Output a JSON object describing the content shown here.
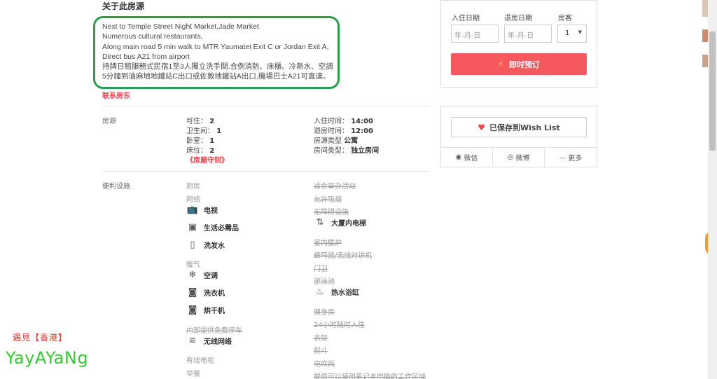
{
  "about": {
    "title": "关于此房源",
    "description": "Next to Temple Street Night Market,Jade Market\nNumerous cultural restaurants,\nAlong main road 5 min walk to MTR Yaumatei Exit C or Jordan Exit A,\nDirect bus A21 from airport\n持牌日租服務式民宿1至3人獨立洗手間,合例消防、床櫃、冷熱水、空調\n5分鐘到油麻地地鐵站C出口或佐敦地鐵站A出口,機場巴士A21可直達。",
    "contact": "联系房东"
  },
  "listing": {
    "section": "房源",
    "left": [
      {
        "k": "可住：",
        "v": "2"
      },
      {
        "k": "卫生间：",
        "v": "1"
      },
      {
        "k": "卧室：",
        "v": "1"
      },
      {
        "k": "床位：",
        "v": "2"
      }
    ],
    "rules": "《房屋守则》",
    "right": [
      {
        "k": "入住时间：",
        "v": "14:00"
      },
      {
        "k": "退房时间：",
        "v": "12:00"
      },
      {
        "k": "房源类型",
        "v": "公寓"
      },
      {
        "k": "房间类型：",
        "v": "独立房间"
      }
    ]
  },
  "amenities": {
    "section": "便利设施",
    "col1": [
      {
        "t": "厨房",
        "s": "off2"
      },
      {
        "t": "网络",
        "s": "off2"
      },
      {
        "t": "电视",
        "s": "on",
        "icon": "tv-icon",
        "g": "📺"
      },
      {
        "t": "生活必需品",
        "s": "on",
        "icon": "essentials-icon",
        "g": "▣"
      },
      {
        "t": "洗发水",
        "s": "on",
        "icon": "shampoo-icon",
        "g": "▯"
      },
      {
        "t": "暖气",
        "s": "off2"
      },
      {
        "t": "空调",
        "s": "on",
        "icon": "snowflake-icon",
        "g": "❄"
      },
      {
        "t": "洗衣机",
        "s": "on",
        "icon": "washer-icon",
        "g": "◙"
      },
      {
        "t": "烘干机",
        "s": "on",
        "icon": "dryer-icon",
        "g": "◙"
      },
      {
        "t": "内部提供免费停车",
        "s": "off"
      },
      {
        "t": "无线网络",
        "s": "on",
        "icon": "wifi-icon",
        "g": "≋"
      },
      {
        "t": "有线电视",
        "s": "off2"
      },
      {
        "t": "早餐",
        "s": "off2"
      }
    ],
    "col2": [
      {
        "t": "适合举办活动",
        "s": "off"
      },
      {
        "t": "允许吸烟",
        "s": "off"
      },
      {
        "t": "无障碍设施",
        "s": "off"
      },
      {
        "t": "大厦内电梯",
        "s": "on",
        "icon": "elevator-icon",
        "g": "⇅"
      },
      {
        "t": "室内壁炉",
        "s": "off"
      },
      {
        "t": "蜂鸣器/无线对讲机",
        "s": "off"
      },
      {
        "t": "门卫",
        "s": "off"
      },
      {
        "t": "游泳池",
        "s": "off"
      },
      {
        "t": "热水浴缸",
        "s": "on",
        "icon": "hot-tub-icon",
        "g": "♨"
      },
      {
        "t": "健身房",
        "s": "off"
      },
      {
        "t": "24小时随时入住",
        "s": "off"
      },
      {
        "t": "衣架",
        "s": "off"
      },
      {
        "t": "熨斗",
        "s": "off"
      },
      {
        "t": "电吹风",
        "s": "off"
      },
      {
        "t": "提供可以使用笔记本电脑的工作区域",
        "s": "off"
      }
    ]
  },
  "booking": {
    "checkin_label": "入住日期",
    "checkout_label": "退房日期",
    "guests_label": "房客",
    "checkin_placeholder": "年-月-日",
    "checkout_placeholder": "年-月-日",
    "guests_value": "1",
    "book_label": "即时预订"
  },
  "wishlist": {
    "label": "已保存到Wish List",
    "wechat": "微信",
    "weibo": "微博",
    "more": "··· 更多"
  },
  "watermark": {
    "line1": "遇見【香港】",
    "line2": "YayAYaNg"
  },
  "colors": {
    "accent": "#f5585d",
    "highlight": "#26a04a"
  }
}
